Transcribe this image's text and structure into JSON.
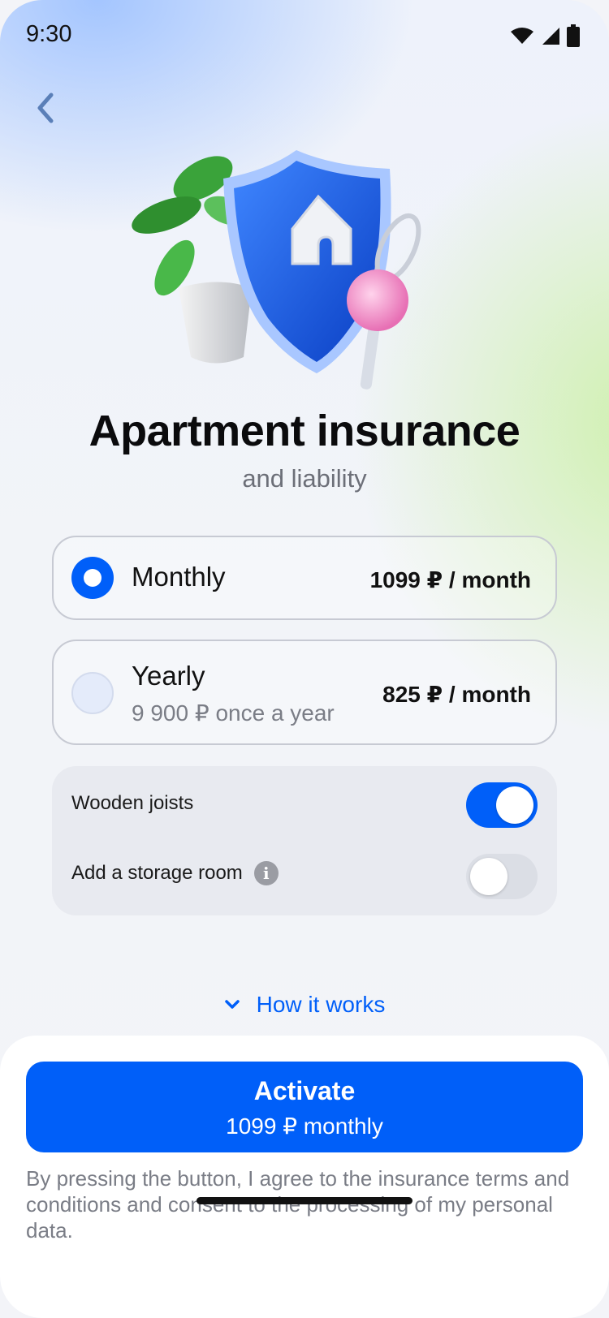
{
  "status_bar": {
    "time": "9:30"
  },
  "header": {
    "back_icon": "chevron-left-icon"
  },
  "hero": {
    "illustration": "shield-house-plant-key-illustration"
  },
  "product": {
    "title": "Apartment insurance",
    "subtitle": "and liability"
  },
  "plans": [
    {
      "name": "Monthly",
      "price": "1099 ₽ / month",
      "selected": true
    },
    {
      "name": "Yearly",
      "detail": "9 900 ₽ once a year",
      "price": "825 ₽ / month",
      "selected": false
    }
  ],
  "options": [
    {
      "label": "Wooden joists",
      "enabled": true
    },
    {
      "label": "Add a storage room",
      "enabled": false,
      "info_icon": "info-icon"
    }
  ],
  "how_it_works": {
    "label": "How it works",
    "icon": "chevron-down-icon"
  },
  "cta": {
    "title": "Activate",
    "subtitle": "1099 ₽ monthly"
  },
  "legal": "By pressing the button, I agree to the insurance terms and conditions and consent to the processing of my personal data.",
  "colors": {
    "accent": "#005ff9",
    "text": "#0b0b0d",
    "muted": "#7a7d86"
  }
}
